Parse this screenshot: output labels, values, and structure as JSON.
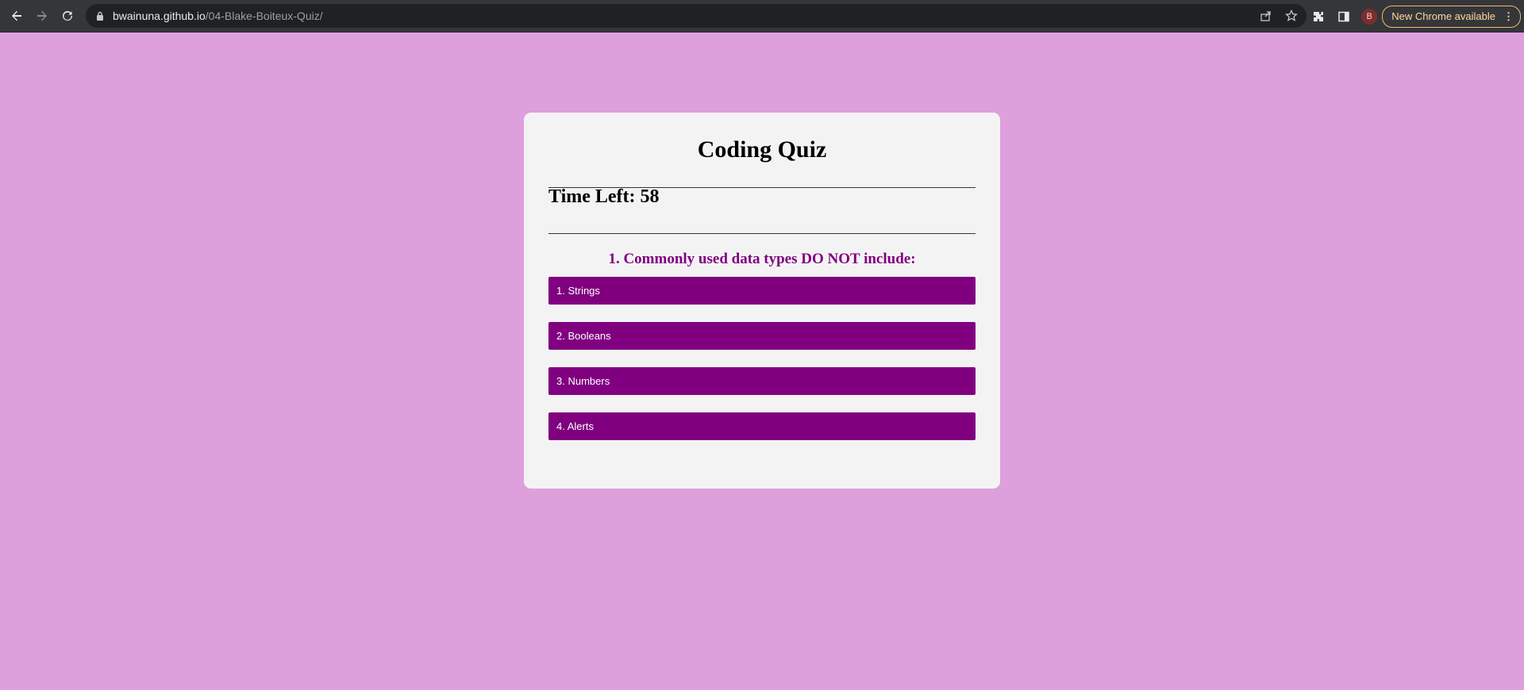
{
  "browser": {
    "url_domain": "bwainuna.github.io",
    "url_path": "/04-Blake-Boiteux-Quiz/",
    "profile_initial": "B",
    "update_label": "New Chrome available",
    "icons": [
      "back-icon",
      "forward-icon",
      "reload-icon",
      "lock-icon",
      "share-icon",
      "star-icon",
      "extensions-icon",
      "side-panel-icon",
      "more-icon"
    ]
  },
  "page": {
    "background_color": "#dda0dd",
    "card_color": "#f4f3f4",
    "accent_color": "#800080",
    "title": "Coding Quiz",
    "timer": "Time Left: 58",
    "question": "1. Commonly used data types DO NOT include:",
    "answers": [
      "1. Strings",
      "2. Booleans",
      "3. Numbers",
      "4. Alerts"
    ]
  }
}
